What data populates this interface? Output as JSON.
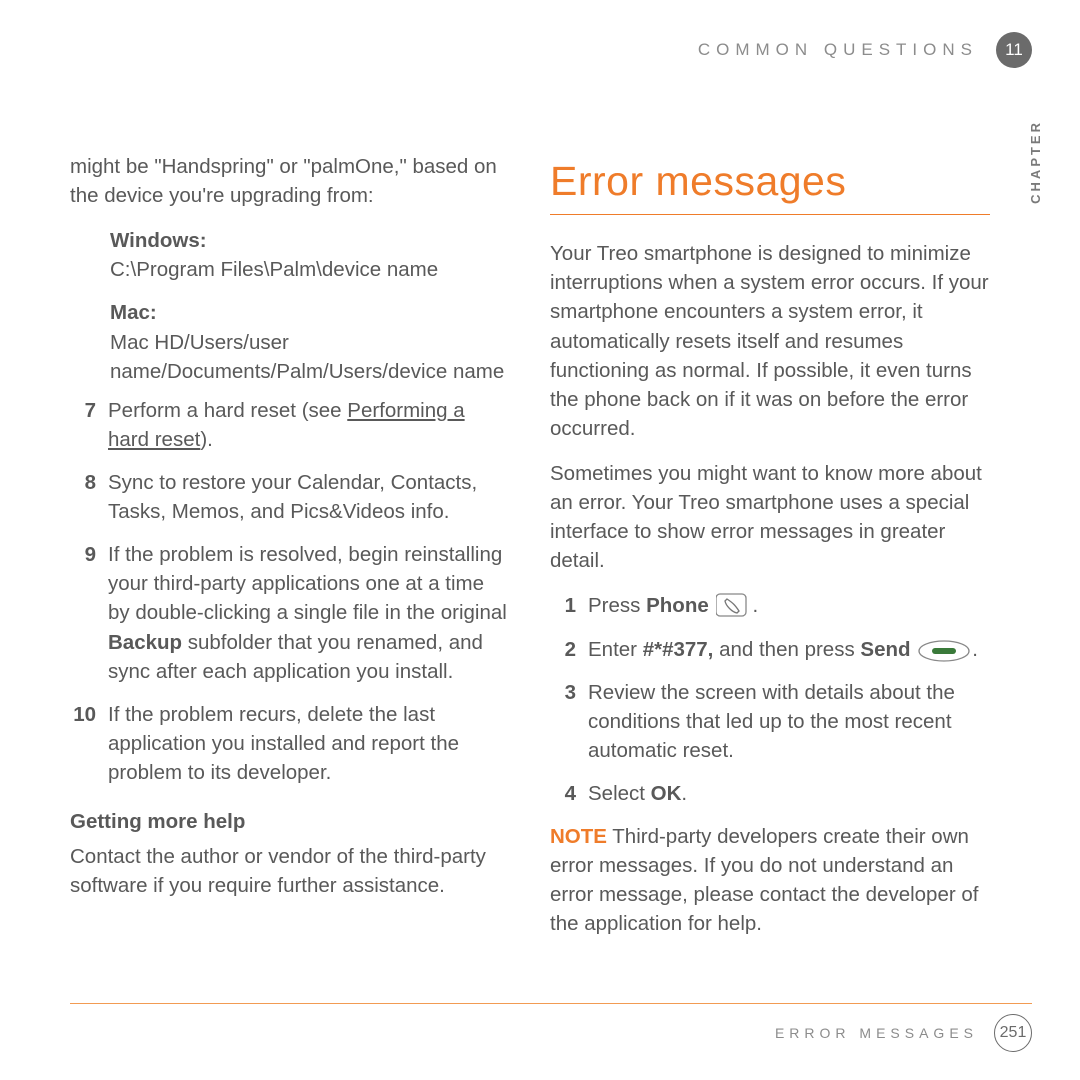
{
  "header": {
    "breadcrumb": "COMMON QUESTIONS",
    "chapter_num": "11",
    "chapter_side": "CHAPTER"
  },
  "left": {
    "intro": "might be \"Handspring\" or \"palmOne,\" based on the device you're upgrading from:",
    "windows_label": "Windows:",
    "windows_path_a": "C:\\Program Files\\Palm\\",
    "windows_path_b": "device name",
    "mac_label": "Mac:",
    "mac_a": "Mac HD/Users/",
    "mac_b": "user name",
    "mac_c": "/Documents/Palm/Users/",
    "mac_d": "device name",
    "steps": {
      "n7": "7",
      "s7a": "Perform a hard reset (see ",
      "s7b": "Performing a hard reset",
      "s7c": ").",
      "n8": "8",
      "s8": "Sync to restore your Calendar, Contacts, Tasks, Memos, and Pics&Videos info.",
      "n9": "9",
      "s9a": "If the problem is resolved, begin reinstalling your third-party applications one at a time by double-clicking a single file in the original ",
      "s9b": "Backup",
      "s9c": " subfolder that you renamed, and sync after each application you install.",
      "n10": "10",
      "s10": "If the problem recurs, delete the last application you installed and report the problem to its developer."
    },
    "help_head": "Getting more help",
    "help_body": "Contact the author or vendor of the third-party software if you require further assistance."
  },
  "right": {
    "title": "Error messages",
    "p1": "Your Treo smartphone is designed to minimize interruptions when a system error occurs. If your smartphone encounters a system error, it automatically resets itself and resumes functioning as normal. If possible, it even turns the phone back on if it was on before the error occurred.",
    "p2": "Sometimes you might want to know more about an error. Your Treo smartphone uses a special interface to show error messages in greater detail.",
    "steps": {
      "n1": "1",
      "s1a": "Press ",
      "s1b": "Phone",
      "s1c": " ",
      "s1d": ".",
      "n2": "2",
      "s2a": "Enter ",
      "s2b": "#*#377,",
      "s2c": " and then press ",
      "s2d": "Send",
      "s2e": " ",
      "s2f": ".",
      "n3": "3",
      "s3": "Review the screen with details about the conditions that led up to the most recent automatic reset.",
      "n4": "4",
      "s4a": "Select ",
      "s4b": "OK",
      "s4c": "."
    },
    "note_label": "NOTE",
    "note_body": "  Third-party developers create their own error messages. If you do not understand an error message, please contact the developer of the application for help."
  },
  "footer": {
    "label": "ERROR MESSAGES",
    "page": "251"
  }
}
